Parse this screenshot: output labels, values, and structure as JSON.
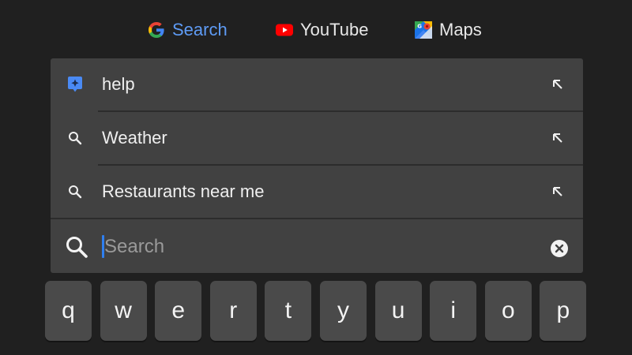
{
  "app_links": {
    "search": {
      "label": "Search",
      "icon": "google-g-icon",
      "color": "#5e9bf5"
    },
    "youtube": {
      "label": "YouTube",
      "icon": "youtube-icon",
      "color": "#ff0000"
    },
    "maps": {
      "label": "Maps",
      "icon": "google-maps-icon"
    }
  },
  "suggestions": [
    {
      "label": "help",
      "icon": "assistant-icon",
      "action_icon": "arrow-up-left-icon"
    },
    {
      "label": "Weather",
      "icon": "search-icon",
      "action_icon": "arrow-up-left-icon"
    },
    {
      "label": "Restaurants near me",
      "icon": "search-icon",
      "action_icon": "arrow-up-left-icon"
    }
  ],
  "search_field": {
    "placeholder": "Search",
    "value": "",
    "clear_icon": "clear-icon"
  },
  "keyboard": {
    "row1": [
      "q",
      "w",
      "e",
      "r",
      "t",
      "y",
      "u",
      "i",
      "o",
      "p"
    ]
  },
  "colors": {
    "background": "#202020",
    "panel": "#414141",
    "key": "#4a4a4a",
    "accent": "#2f7ff0"
  }
}
